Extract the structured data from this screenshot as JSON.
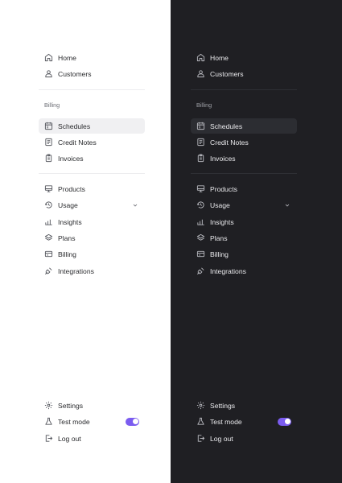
{
  "colors": {
    "light_bg": "#ffffff",
    "dark_bg": "#1f1f23",
    "accent": "#7b5cf0"
  },
  "nav": {
    "home": "Home",
    "customers": "Customers",
    "billing_section": "Billing",
    "schedules": "Schedules",
    "credit_notes": "Credit Notes",
    "invoices": "Invoices",
    "products": "Products",
    "usage": "Usage",
    "insights": "Insights",
    "plans": "Plans",
    "billing": "Billing",
    "integrations": "Integrations",
    "settings": "Settings",
    "test_mode": "Test mode",
    "log_out": "Log out"
  },
  "icons": {
    "home": "home-icon",
    "customers": "user-icon",
    "schedules": "calendar-icon",
    "credit_notes": "receipt-icon",
    "invoices": "clipboard-icon",
    "products": "monitor-icon",
    "usage": "gauge-icon",
    "insights": "bar-chart-icon",
    "plans": "layers-icon",
    "billing": "credit-card-icon",
    "integrations": "plug-icon",
    "settings": "gear-icon",
    "test_mode": "flask-icon",
    "log_out": "logout-icon"
  },
  "state": {
    "active_item": "Schedules",
    "usage_expanded": false,
    "test_mode_enabled": true
  }
}
